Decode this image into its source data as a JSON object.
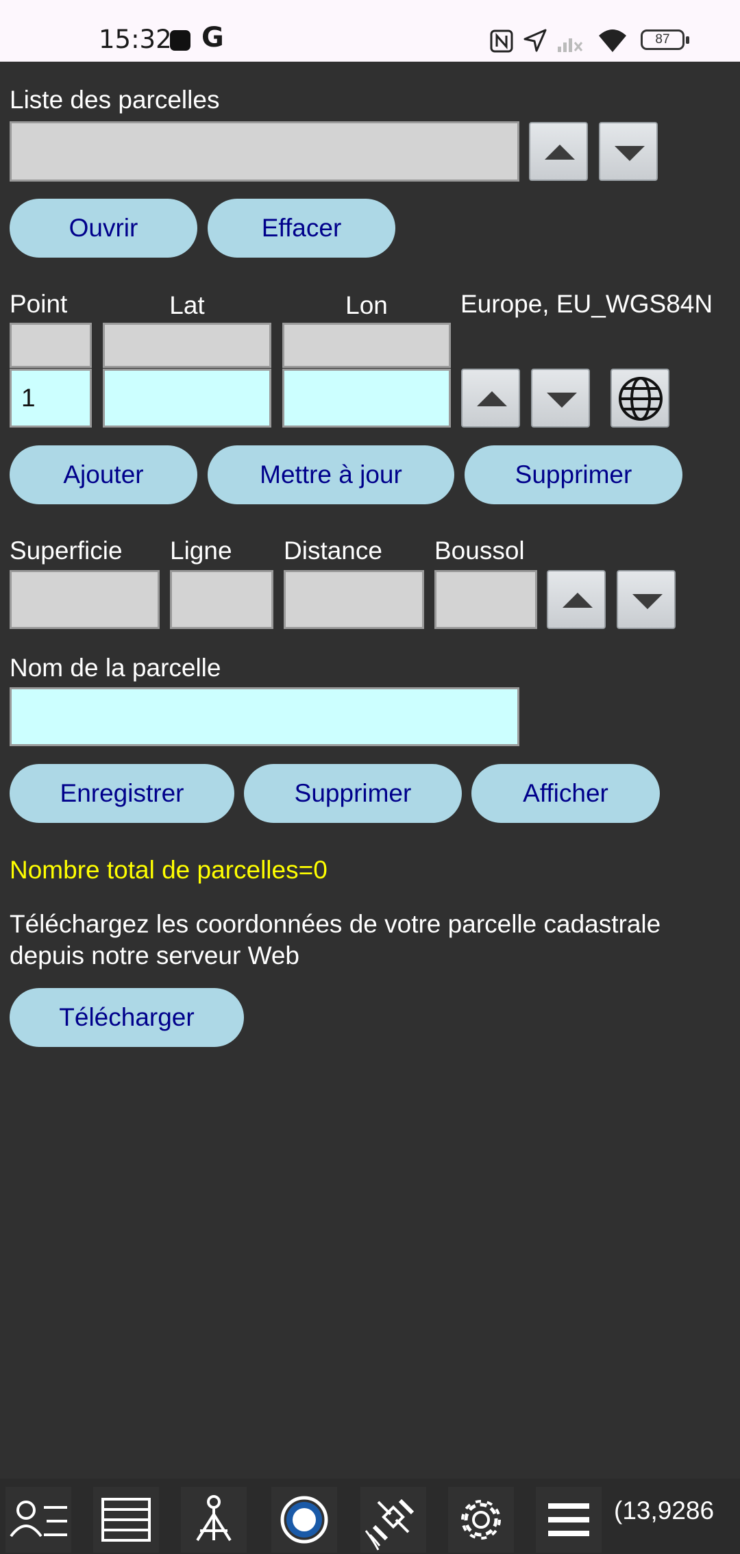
{
  "status_bar": {
    "time": "15:32",
    "battery": "87"
  },
  "parcel_list": {
    "label": "Liste des parcelles",
    "value": ""
  },
  "buttons_row1": {
    "open": "Ouvrir",
    "clear": "Effacer"
  },
  "points": {
    "headers": {
      "point": "Point",
      "lat": "Lat",
      "lon": "Lon"
    },
    "datum": "Europe, EU_WGS84N",
    "point_value": "1",
    "lat_value": "",
    "lon_value": ""
  },
  "buttons_row2": {
    "add": "Ajouter",
    "update": "Mettre à jour",
    "delete": "Supprimer"
  },
  "measures": {
    "area": "Superficie",
    "line": "Ligne",
    "distance": "Distance",
    "compass": "Boussol"
  },
  "parcel_name": {
    "label": "Nom de la parcelle",
    "value": ""
  },
  "buttons_row3": {
    "save": "Enregistrer",
    "delete": "Supprimer",
    "show": "Afficher"
  },
  "total": "Nombre total de parcelles=0",
  "download_text": "Téléchargez les coordonnées de votre parcelle cadastrale depuis notre serveur Web",
  "download_button": "Télécharger",
  "bottom_nav": {
    "icons": [
      "user-list-icon",
      "layers-icon",
      "survey-point-icon",
      "record-icon",
      "satellite-icon",
      "gear-icon",
      "menu-icon"
    ],
    "coordinate": "(13,9286"
  },
  "colors": {
    "background": "#303030",
    "pill": "#add8e6",
    "pill_text": "#00008b",
    "input_cyan": "#ccffff",
    "input_grey": "#d3d3d3",
    "total_text": "#ffff00"
  }
}
